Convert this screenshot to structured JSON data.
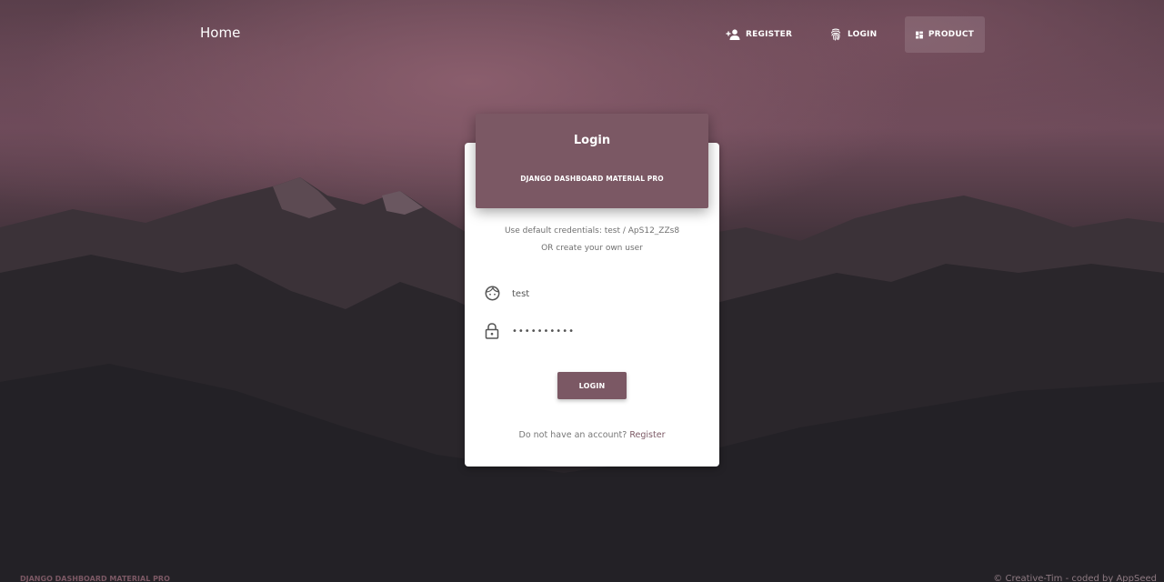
{
  "navbar": {
    "brand": "Home",
    "items": [
      {
        "label": "REGISTER",
        "icon": "person-add-icon"
      },
      {
        "label": "LOGIN",
        "icon": "fingerprint-icon"
      },
      {
        "label": "PRODUCT",
        "icon": "dashboard-icon"
      }
    ]
  },
  "card": {
    "title": "Login",
    "subtitle": "DJANGO DASHBOARD MATERIAL PRO",
    "hint_line1": "Use default credentials: test / ApS12_ZZs8",
    "hint_line2": "OR create your own user",
    "username_value": "test",
    "password_value": "••••••••••",
    "login_button": "LOGIN",
    "signup_prompt": "Do not have an account?",
    "signup_link": "Register"
  },
  "footer": {
    "left": "DJANGO DASHBOARD MATERIAL PRO",
    "right": "© Creative-Tim - coded by AppSeed"
  },
  "colors": {
    "accent": "#7b5864",
    "background": "#1f1e22"
  }
}
